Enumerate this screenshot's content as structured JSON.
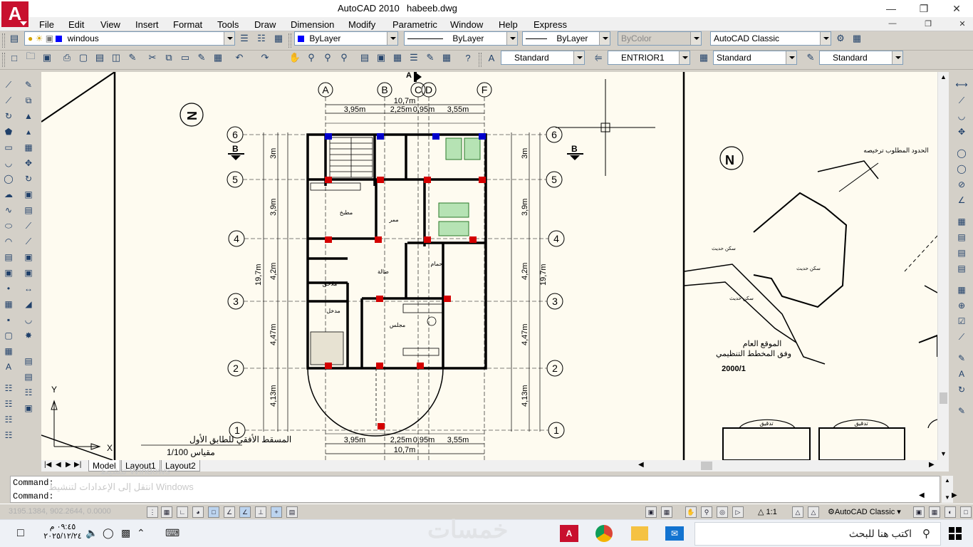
{
  "titlebar": {
    "app": "AutoCAD 2010",
    "file": "habeeb.dwg",
    "logo": "A"
  },
  "menu": [
    "File",
    "Edit",
    "View",
    "Insert",
    "Format",
    "Tools",
    "Draw",
    "Dimension",
    "Modify",
    "Parametric",
    "Window",
    "Help",
    "Express"
  ],
  "toolbar1": {
    "layer": "windous",
    "color": "ByLayer",
    "linetype": "ByLayer",
    "lineweight": "ByLayer",
    "plotstyle": "ByColor",
    "workspace": "AutoCAD Classic"
  },
  "toolbar2": {
    "text_style": "Standard",
    "dim_style": "ENTRIOR1",
    "table_style": "Standard",
    "mleader_style": "Standard"
  },
  "grid": {
    "columns": [
      "A",
      "B",
      "C",
      "D",
      "F"
    ],
    "rows": [
      "6",
      "5",
      "4",
      "3",
      "2",
      "1"
    ],
    "section_marks": [
      "A",
      "B",
      "B"
    ]
  },
  "dimensions": {
    "overall_width": "10,7m",
    "col_spans": [
      "3,95m",
      "2,25m",
      "0,95m",
      "3,55m"
    ],
    "overall_height": "19,7m",
    "row_spans_left": [
      "3m",
      "3,9m",
      "4,2m",
      "4,47m",
      "4,13m"
    ],
    "row_spans_right": [
      "3m",
      "3,9m",
      "4,2m",
      "4,47m",
      "4,13m"
    ]
  },
  "plan_labels": {
    "title": "المسقط الأفقي للطابق الأول",
    "scale": "مقياس 1/100",
    "rooms": [
      "مطبخ",
      "ممر",
      "حمام",
      "صالة",
      "مجلس",
      "مدخل",
      "ملاحق"
    ]
  },
  "site_plan": {
    "header": "الحدود المطلوب ترخيصه",
    "caption_1": "الموقع العام",
    "caption_2": "وفق المخطط التنظيمي",
    "scale": "2000/1",
    "neighbors": [
      "سكن حديث",
      "سكن حديث",
      "سكن حديث"
    ],
    "boxes": [
      "تدقيق",
      "تدقيق"
    ]
  },
  "layout_tabs": [
    "Model",
    "Layout1",
    "Layout2"
  ],
  "commands": [
    "Command:",
    "Command:"
  ],
  "status": {
    "coords": "3195.1384, 902.2644, 0.0000",
    "scale": "1:1",
    "workspace": "AutoCAD Classic"
  },
  "watermark": {
    "line1": "تنشيط Windows",
    "line2": "انتقل إلى الإعدادات لتنشيط Windows",
    "logo": "خمسات"
  },
  "taskbar": {
    "search_placeholder": "اكتب هنا للبحث",
    "time": "٠٩:٤٥ م",
    "date": "٢٠٢٥/١٢/٢٤"
  },
  "colors": {
    "accent_red": "#c8102e",
    "canvas": "#fefbf0",
    "blue": "#0000ff"
  }
}
